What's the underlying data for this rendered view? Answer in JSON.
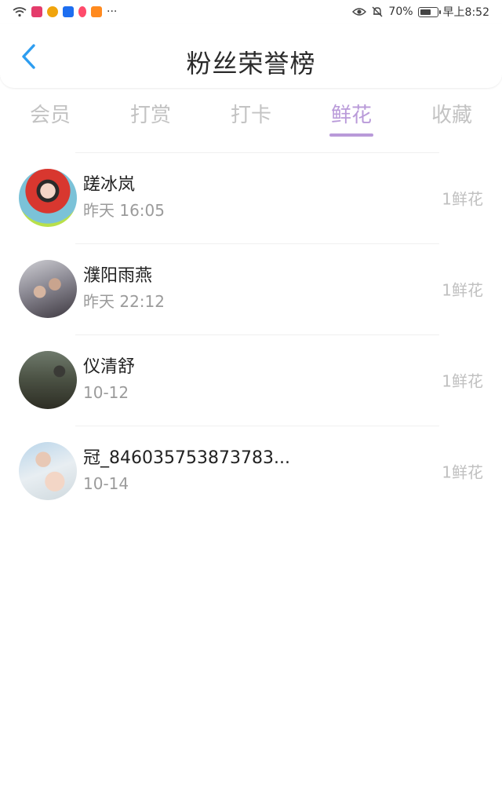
{
  "status_bar": {
    "battery_text": "70%",
    "battery_level": 0.7,
    "time": "早上8:52",
    "app_icon_colors": [
      "#e43c6b",
      "#f0a40c",
      "#1d6ef0",
      "#ff4b6b",
      "#ff8a1f"
    ],
    "more": "···"
  },
  "header": {
    "back_icon": "chevron-left-icon",
    "title": "粉丝荣誉榜",
    "accent_color": "#2d9df0"
  },
  "tabs": [
    {
      "label": "会员",
      "active": false
    },
    {
      "label": "打赏",
      "active": false
    },
    {
      "label": "打卡",
      "active": false
    },
    {
      "label": "鲜花",
      "active": true
    },
    {
      "label": "收藏",
      "active": false
    }
  ],
  "active_tab_color": "#b99ad9",
  "list": [
    {
      "name": "蹉冰岚",
      "time": "昨天 16:05",
      "count": "1鲜花"
    },
    {
      "name": "濮阳雨燕",
      "time": "昨天 22:12",
      "count": "1鲜花"
    },
    {
      "name": "仪清舒",
      "time": "10-12",
      "count": "1鲜花"
    },
    {
      "name": "冠_846035753873783...",
      "time": "10-14",
      "count": "1鲜花"
    }
  ]
}
